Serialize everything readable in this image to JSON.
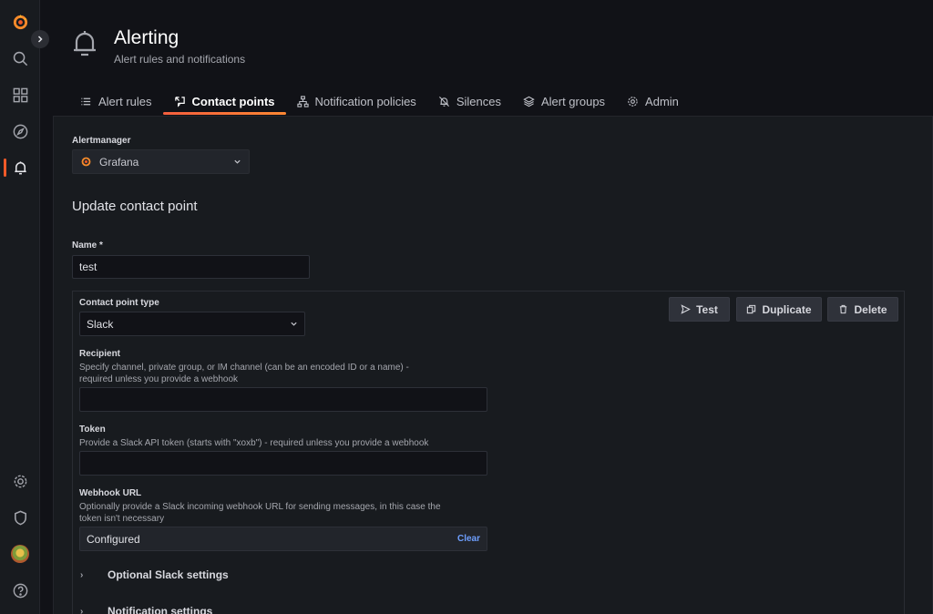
{
  "sidebar": {
    "items": [
      {
        "name": "grafana-logo-icon"
      },
      {
        "name": "search-icon"
      },
      {
        "name": "dashboards-icon"
      },
      {
        "name": "explore-icon"
      },
      {
        "name": "alerting-bell-icon"
      },
      {
        "name": "settings-gear-icon"
      },
      {
        "name": "shield-icon"
      },
      {
        "name": "user-avatar"
      },
      {
        "name": "help-icon"
      }
    ]
  },
  "header": {
    "title": "Alerting",
    "subtitle": "Alert rules and notifications"
  },
  "tabs": [
    {
      "label": "Alert rules",
      "icon": "list-icon",
      "active": false
    },
    {
      "label": "Contact points",
      "icon": "comment-alt-share-icon",
      "active": true
    },
    {
      "label": "Notification policies",
      "icon": "sitemap-icon",
      "active": false
    },
    {
      "label": "Silences",
      "icon": "bell-slash-icon",
      "active": false
    },
    {
      "label": "Alert groups",
      "icon": "layer-group-icon",
      "active": false
    },
    {
      "label": "Admin",
      "icon": "cog-icon",
      "active": false
    }
  ],
  "alertmanager": {
    "label": "Alertmanager",
    "selected": "Grafana"
  },
  "form": {
    "section_title": "Update contact point",
    "name_label": "Name *",
    "name_value": "test",
    "contact_type_label": "Contact point type",
    "contact_type_value": "Slack",
    "buttons": {
      "test": "Test",
      "duplicate": "Duplicate",
      "delete": "Delete"
    },
    "recipient": {
      "label": "Recipient",
      "description": "Specify channel, private group, or IM channel (can be an encoded ID or a name) - required unless you provide a webhook",
      "value": ""
    },
    "token": {
      "label": "Token",
      "description": "Provide a Slack API token (starts with \"xoxb\") - required unless you provide a webhook",
      "value": ""
    },
    "webhook": {
      "label": "Webhook URL",
      "description": "Optionally provide a Slack incoming webhook URL for sending messages, in this case the token isn't necessary",
      "value": "Configured",
      "clear_label": "Clear"
    },
    "optional_settings": "Optional Slack settings",
    "notification_settings": "Notification settings"
  },
  "colors": {
    "accent": "#f05a28",
    "link": "#6e9fff",
    "background": "#111217",
    "panel": "#181b1f"
  }
}
